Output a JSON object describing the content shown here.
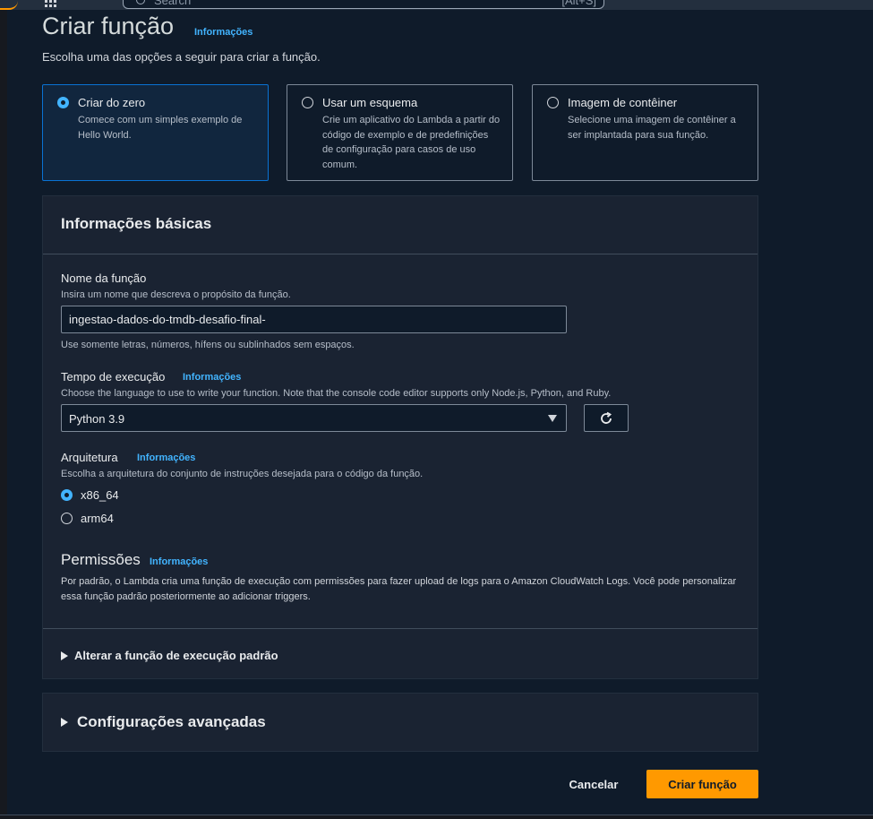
{
  "topbar": {
    "search_placeholder": "Search",
    "search_shortcut": "[Alt+S]"
  },
  "page": {
    "title": "Criar função",
    "info": "Informações",
    "subtitle": "Escolha uma das opções a seguir para criar a função."
  },
  "options": [
    {
      "title": "Criar do zero",
      "desc": "Comece com um simples exemplo de Hello World.",
      "selected": true
    },
    {
      "title": "Usar um esquema",
      "desc": "Crie um aplicativo do Lambda a partir do código de exemplo e de predefinições de configuração para casos de uso comum.",
      "selected": false
    },
    {
      "title": "Imagem de contêiner",
      "desc": "Selecione uma imagem de contêiner a ser implantada para sua função.",
      "selected": false
    }
  ],
  "basic": {
    "header": "Informações básicas",
    "name_label": "Nome da função",
    "name_hint": "Insira um nome que descreva o propósito da função.",
    "name_value": "ingestao-dados-do-tmdb-desafio-final-",
    "name_constraint": "Use somente letras, números, hífens ou sublinhados sem espaços.",
    "runtime_label": "Tempo de execução",
    "runtime_info": "Informações",
    "runtime_hint": "Choose the language to use to write your function. Note that the console code editor supports only Node.js, Python, and Ruby.",
    "runtime_value": "Python 3.9",
    "arch_label": "Arquitetura",
    "arch_info": "Informações",
    "arch_hint": "Escolha a arquitetura do conjunto de instruções desejada para o código da função.",
    "arch_options": [
      {
        "label": "x86_64",
        "selected": true
      },
      {
        "label": "arm64",
        "selected": false
      }
    ],
    "perm_title": "Permissões",
    "perm_info": "Informações",
    "perm_desc": "Por padrão, o Lambda cria uma função de execução com permissões para fazer upload de logs para o Amazon CloudWatch Logs. Você pode personalizar essa função padrão posteriormente ao adicionar triggers.",
    "change_role": "Alterar a função de execução padrão"
  },
  "advanced": {
    "label": "Configurações avançadas"
  },
  "actions": {
    "cancel": "Cancelar",
    "create": "Criar função"
  }
}
